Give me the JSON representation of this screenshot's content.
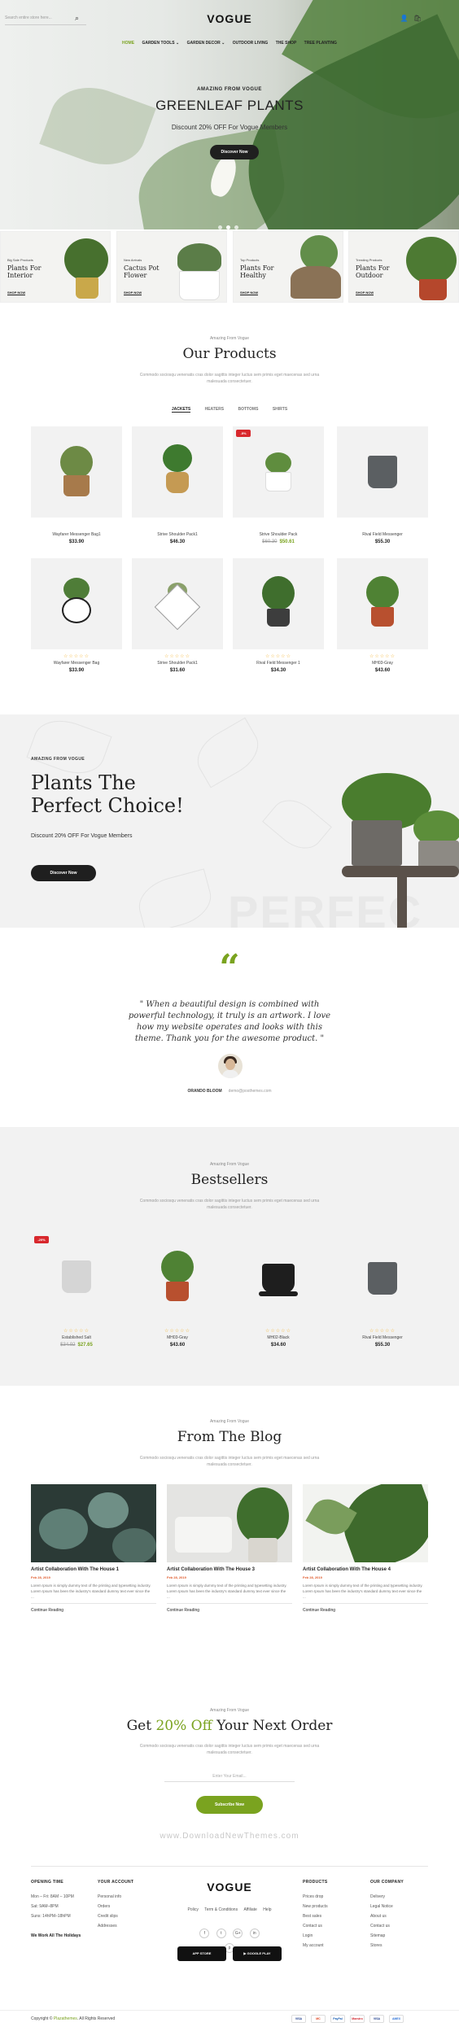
{
  "header": {
    "search_placeholder": "Search entire store here...",
    "logo": "VOGUE",
    "nav": [
      "HOME",
      "GARDEN TOOLS ⌄",
      "GARDEN DECOR ⌄",
      "OUTDOOR LIVING",
      "THE SHOP",
      "TREE PLANTING"
    ]
  },
  "hero": {
    "small": "AMAZING FROM VOGUE",
    "title": "GREENLEAF PLANTS",
    "subtitle": "Discount 20% OFF For Vogue Members",
    "button": "Discover Now"
  },
  "categories": [
    {
      "small": "Big Sale Products",
      "title": "Plants For Interior",
      "link": "SHOP NOW"
    },
    {
      "small": "New Arrivals",
      "title": "Cactus Pot Flower",
      "link": "SHOP NOW"
    },
    {
      "small": "Top Products",
      "title": "Plants For Healthy",
      "link": "SHOP NOW"
    },
    {
      "small": "Trending Products",
      "title": "Plants For Outdoor",
      "link": "SHOP NOW"
    }
  ],
  "our_products": {
    "small": "Amazing From Vogue",
    "title": "Our Products",
    "desc": "Commodo sociosqu venenatis cras dolor sagittis integer luctus sem primis eget maecenas sed urna malesuada consectetuer.",
    "tabs": [
      "JACKETS",
      "HEATERS",
      "BOTTOMS",
      "SHIRTS"
    ],
    "items": [
      {
        "name": "Wayfarer Messenger Bag1",
        "price": "$33.90",
        "stars": "☆☆☆☆☆"
      },
      {
        "name": "Strive Shoulder Pack1",
        "price": "$46.30",
        "stars": "☆☆☆☆☆"
      },
      {
        "name": "Strive Shoulder Pack",
        "old": "$60.30",
        "price": "$50.61",
        "badge": "-5%",
        "stars": "☆☆☆☆☆"
      },
      {
        "name": "Rival Field Messenger",
        "price": "$55.30",
        "stars": "☆☆☆☆☆"
      },
      {
        "name": "Wayfarer Messenger Bag",
        "price": "$33.90",
        "stars": "☆☆☆☆☆"
      },
      {
        "name": "Strive Shoulder Pack1",
        "price": "$31.60",
        "stars": "☆☆☆☆☆"
      },
      {
        "name": "Rival Field Messenger 1",
        "price": "$34.30",
        "stars": "☆☆☆☆☆"
      },
      {
        "name": "MH03-Gray",
        "price": "$43.60",
        "stars": "☆☆☆☆☆"
      }
    ]
  },
  "promo": {
    "small": "AMAZING FROM VOGUE",
    "title_line1": "Plants The",
    "title_line2": "Perfect Choice!",
    "subtitle": "Discount 20% OFF For Vogue Members",
    "button": "Discover Now",
    "ghost": "PERFEC"
  },
  "testimonial": {
    "quote": "\" When a beautiful design is combined with powerful technology, it truly is an artwork. I love how my website operates and looks with this theme. Thank you for the awesome product. \"",
    "author": "ORANDO BLOOM",
    "email": "demo@posthemes.com"
  },
  "bestsellers": {
    "small": "Amazing From Vogue",
    "title": "Bestsellers",
    "desc": "Commodo sociosqu venenatis cras dolor sagittis integer luctus sem primis eget maecenas sed urna malesuada consectetuer.",
    "items": [
      {
        "name": "Established Salt",
        "old": "$34.92",
        "price": "$27.65",
        "badge": "-20%",
        "stars": "☆☆☆☆☆"
      },
      {
        "name": "MH03-Gray",
        "price": "$43.60",
        "stars": "☆☆☆☆☆"
      },
      {
        "name": "MH02-Black",
        "price": "$34.60",
        "stars": "☆☆☆☆☆"
      },
      {
        "name": "Rival Field Messenger",
        "price": "$55.30",
        "stars": "☆☆☆☆☆"
      }
    ]
  },
  "blog": {
    "small": "Amazing From Vogue",
    "title": "From The Blog",
    "desc": "Commodo sociosqu venenatis cras dolor sagittis integer luctus sem primis eget maecenas sed urna malesuada consectetuer.",
    "posts": [
      {
        "title": "Artist Collaboration With The House 1",
        "date": "Feb 28, 2019",
        "text": "Lorem Ipsum is simply dummy text of the printing and typesetting industry. Lorem Ipsum has been the industry's standard dummy text ever since the ...",
        "more": "Continue Reading"
      },
      {
        "title": "Artist Collaboration With The House 3",
        "date": "Feb 28, 2019",
        "text": "Lorem Ipsum is simply dummy text of the printing and typesetting industry. Lorem Ipsum has been the industry's standard dummy text ever since the ...",
        "more": "Continue Reading"
      },
      {
        "title": "Artist Collaboration With The House 4",
        "date": "Feb 28, 2019",
        "text": "Lorem Ipsum is simply dummy text of the printing and typesetting industry. Lorem Ipsum has been the industry's standard dummy text ever since the ...",
        "more": "Continue Reading"
      }
    ]
  },
  "newsletter": {
    "small": "Amazing From Vogue",
    "title_pre": "Get ",
    "title_accent": "20% Off",
    "title_post": " Your Next Order",
    "desc": "Commodo sociosqu venenatis cras dolor sagittis integer luctus sem primis eget maecenas sed urna malesuada consectetuer.",
    "placeholder": "Enter Your Email...",
    "button": "Subscribe Now",
    "watermark": "www.DownloadNewThemes.com"
  },
  "footer": {
    "opening": {
      "head": "OPENING TIME",
      "lines": [
        "Mon – Fri: 8AM – 10PM",
        "Sat: 9AM–8PM",
        "Suns: 14hPM–18hPM",
        "",
        "We Work All The Holidays"
      ]
    },
    "account": {
      "head": "YOUR ACCOUNT",
      "lines": [
        "Personal info",
        "Orders",
        "Credit slips",
        "Addresses"
      ]
    },
    "logo": "VOGUE",
    "links": [
      "Policy",
      "Term & Conditions",
      "Affiliate",
      "Help"
    ],
    "social": [
      "f",
      "t",
      "G+",
      "in",
      "p"
    ],
    "appstore": "APP STORE",
    "googleplay": "GOOGLE PLAY",
    "products": {
      "head": "PRODUCTS",
      "lines": [
        "Prices drop",
        "New products",
        "Best sales",
        "Contact us",
        "Login",
        "My account"
      ]
    },
    "company": {
      "head": "OUR COMPANY",
      "lines": [
        "Delivery",
        "Legal Notice",
        "About us",
        "Contact us",
        "Sitemap",
        "Stores"
      ]
    },
    "copyright_pre": "Copyright © ",
    "copyright_brand": "Plazathemes",
    "copyright_post": ". All Rights Reserved",
    "payments": [
      "VISA",
      "MC",
      "PayPal",
      "Maestro",
      "VISA",
      "AMEX"
    ]
  },
  "colors": {
    "accent": "#7aa31f",
    "dark": "#1f1f1f",
    "sale": "#d8282d",
    "gray_bg": "#f2f2f2"
  }
}
